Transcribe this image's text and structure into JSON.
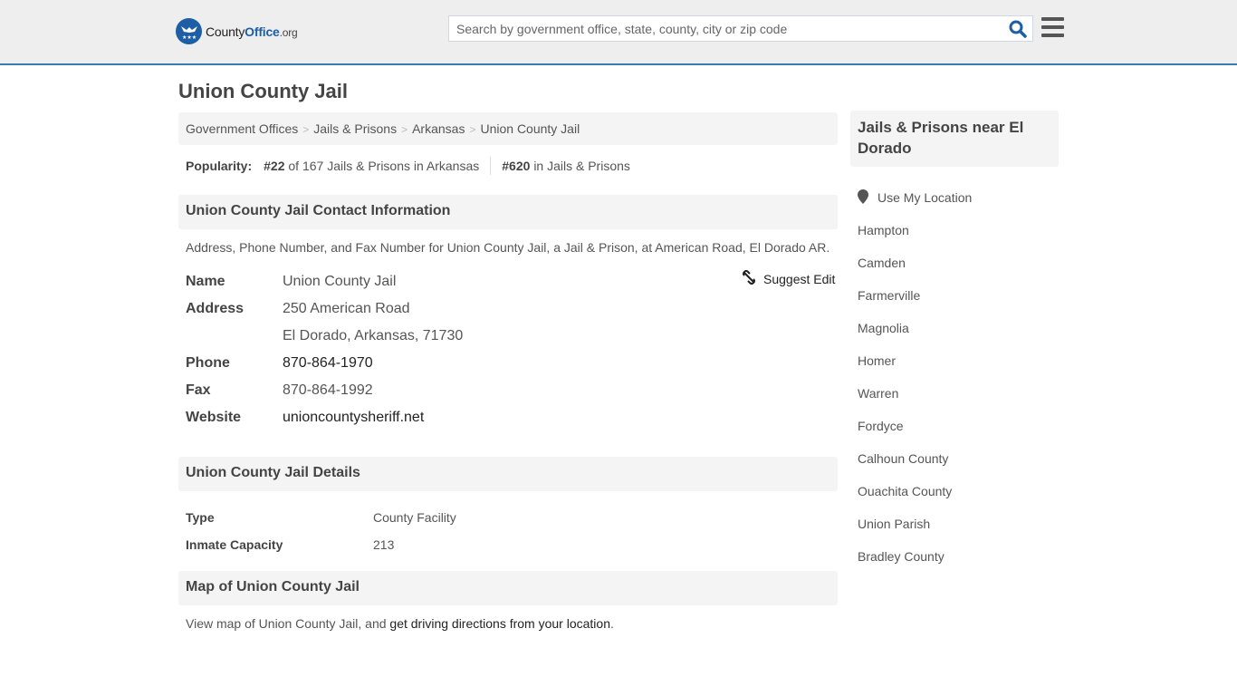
{
  "header": {
    "logo": {
      "text_county": "County",
      "text_office": "Office",
      "text_org": ".org"
    },
    "search": {
      "placeholder": "Search by government office, state, county, city or zip code",
      "value": ""
    },
    "icons": {
      "search": "search-icon",
      "menu": "hamburger-menu-icon"
    },
    "accent_color": "#3a7cb0"
  },
  "page": {
    "title": "Union County Jail",
    "breadcrumb": [
      {
        "label": "Government Offices"
      },
      {
        "label": "Jails & Prisons"
      },
      {
        "label": "Arkansas"
      },
      {
        "label": "Union County Jail"
      }
    ],
    "breadcrumb_separator": ">",
    "popularity": {
      "label": "Popularity:",
      "state_rank": "#22",
      "state_rank_text": "of 167 Jails & Prisons in Arkansas",
      "national_rank": "#620",
      "national_rank_text": "in Jails & Prisons"
    }
  },
  "contact": {
    "heading": "Union County Jail Contact Information",
    "description": "Address, Phone Number, and Fax Number for Union County Jail, a Jail & Prison, at American Road, El Dorado AR.",
    "suggest_edit": "Suggest Edit",
    "fields": {
      "name_label": "Name",
      "name_value": "Union County Jail",
      "address_label": "Address",
      "address_line1": "250 American Road",
      "address_line2": "El Dorado, Arkansas, 71730",
      "phone_label": "Phone",
      "phone_value": "870-864-1970",
      "fax_label": "Fax",
      "fax_value": "870-864-1992",
      "website_label": "Website",
      "website_value": "unioncountysheriff.net"
    }
  },
  "details": {
    "heading": "Union County Jail Details",
    "type_label": "Type",
    "type_value": "County Facility",
    "capacity_label": "Inmate Capacity",
    "capacity_value": "213"
  },
  "map": {
    "heading": "Map of Union County Jail",
    "text_prefix": "View map of Union County Jail, and ",
    "link": "get driving directions from your location",
    "text_suffix": "."
  },
  "sidebar": {
    "heading": "Jails & Prisons near El Dorado",
    "use_location": "Use My Location",
    "items": [
      {
        "label": "Hampton"
      },
      {
        "label": "Camden"
      },
      {
        "label": "Farmerville"
      },
      {
        "label": "Magnolia"
      },
      {
        "label": "Homer"
      },
      {
        "label": "Warren"
      },
      {
        "label": "Fordyce"
      },
      {
        "label": "Calhoun County"
      },
      {
        "label": "Ouachita County"
      },
      {
        "label": "Union Parish"
      },
      {
        "label": "Bradley County"
      }
    ]
  }
}
